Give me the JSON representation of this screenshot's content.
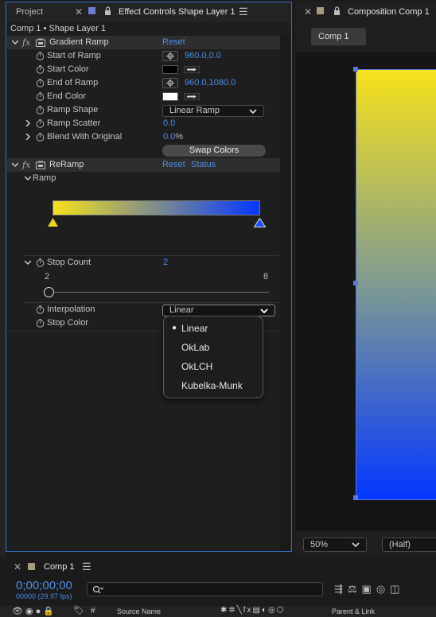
{
  "left_panel": {
    "project_tab": "Project",
    "effect_controls_tab": "Effect Controls Shape Layer 1",
    "layer_path": "Comp 1 • Shape Layer 1",
    "effects": [
      {
        "name": "Gradient Ramp",
        "reset": "Reset",
        "properties": [
          {
            "label": "Start of Ramp",
            "value": "960.0,0.0"
          },
          {
            "label": "Start Color",
            "color": "#000000"
          },
          {
            "label": "End of Ramp",
            "value": "960.0,1080.0"
          },
          {
            "label": "End Color",
            "color": "#ffffff"
          },
          {
            "label": "Ramp Shape",
            "value": "Linear Ramp"
          },
          {
            "label": "Ramp Scatter",
            "value": "0.0"
          },
          {
            "label": "Blend With Original",
            "value": "0.0",
            "unit": "%"
          }
        ],
        "swap_button": "Swap Colors"
      },
      {
        "name": "ReRamp",
        "reset": "Reset",
        "status": "Status",
        "ramp_label": "Ramp",
        "ramp_colors": {
          "start": "#f7e21c",
          "end": "#0437ff"
        },
        "stop_count_label": "Stop Count",
        "stop_count_value": "2",
        "slider_min": "2",
        "slider_max": "8",
        "slider_level": 0,
        "interpolation_label": "Interpolation",
        "interpolation_value": "Linear",
        "stop_color_label": "Stop Color"
      }
    ]
  },
  "interpolation_menu": {
    "options": [
      "Linear",
      "OkLab",
      "OkLCH",
      "Kubelka-Munk"
    ],
    "selected": "Linear"
  },
  "composition_panel": {
    "tab": "Composition Comp 1",
    "comp_button": "Comp 1",
    "zoom": "50%",
    "resolution": "(Half)",
    "gradient_colors": {
      "top": "#f7e21c",
      "bottom": "#0437ff"
    }
  },
  "timeline": {
    "tab": "Comp 1",
    "timecode": "0;00;00;00",
    "frame_info": "00000 (29.97 fps)",
    "source_name_header": "Source Name",
    "parent_link_header": "Parent & Link"
  },
  "colors": {
    "accent": "#4a8fe7",
    "panel_border": "#2f6fcc"
  }
}
